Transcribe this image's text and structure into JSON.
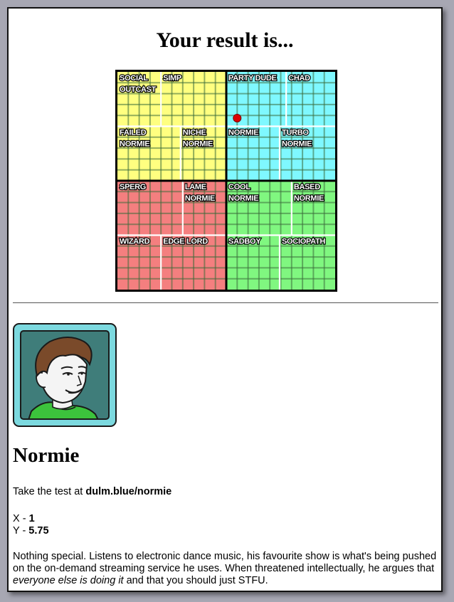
{
  "page": {
    "title": "Your result is..."
  },
  "grid": {
    "quadrant_colors": {
      "top_left": "#ffff80",
      "top_right": "#7ff8ff",
      "bottom_left": "#f47f7f",
      "bottom_right": "#80f780"
    },
    "point_color": "#dd0000",
    "cells": [
      {
        "label_lines": [
          "SOCIAL",
          "OUTCAST"
        ]
      },
      {
        "label_lines": [
          "SIMP"
        ]
      },
      {
        "label_lines": [
          "PARTY DUDE"
        ]
      },
      {
        "label_lines": [
          "CHAD"
        ]
      },
      {
        "label_lines": [
          "FAILED",
          "NORMIE"
        ]
      },
      {
        "label_lines": [
          "NICHE",
          "NORMIE"
        ]
      },
      {
        "label_lines": [
          "NORMIE"
        ]
      },
      {
        "label_lines": [
          "TURBO",
          "NORMIE"
        ]
      },
      {
        "label_lines": [
          "SPERG"
        ]
      },
      {
        "label_lines": [
          "LAME",
          "NORMIE"
        ]
      },
      {
        "label_lines": [
          "COOL",
          "NORMIE"
        ]
      },
      {
        "label_lines": [
          "BASED",
          "NORMIE"
        ]
      },
      {
        "label_lines": [
          "WIZARD"
        ]
      },
      {
        "label_lines": [
          "EDGE LORD"
        ]
      },
      {
        "label_lines": [
          "SADBOY"
        ]
      },
      {
        "label_lines": [
          "SOCIOPATH"
        ]
      }
    ],
    "point": {
      "x": 1,
      "y": 5.75
    }
  },
  "result": {
    "name": "Normie",
    "test_prefix": "Take the test at ",
    "test_link": "dulm.blue/normie",
    "x_label": "X - ",
    "x_value": "1",
    "y_label": "Y - ",
    "y_value": "5.75",
    "desc_part1": "Nothing special. Listens to electronic dance music, his favourite show is what's being pushed on the on-demand streaming service he uses. When threatened intellectually, he argues that ",
    "desc_emphasis": "everyone else is doing it",
    "desc_part2": " and that you should just STFU."
  },
  "avatar": {
    "icon": "normie-face-icon",
    "frame_color": "#7cd9df",
    "background_color": "#3f7d7a"
  }
}
